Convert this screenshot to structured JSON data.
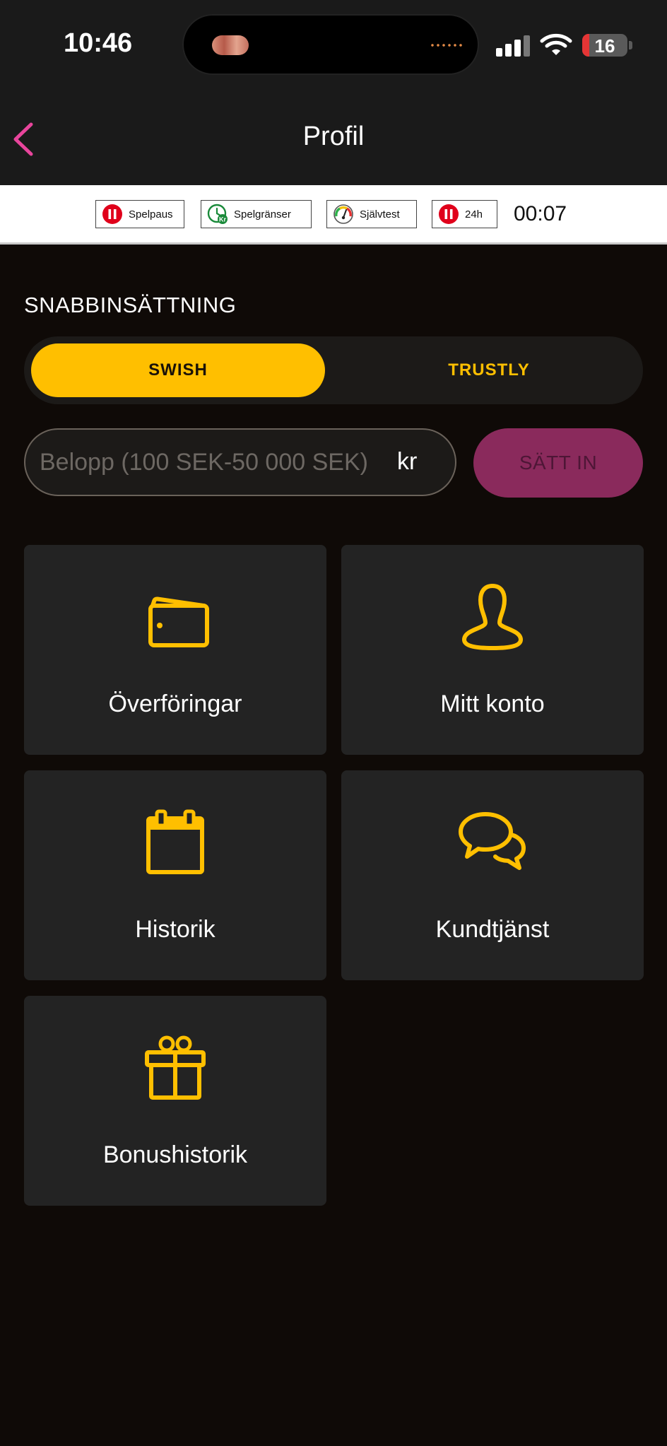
{
  "status_bar": {
    "time": "10:46",
    "battery_level": "16"
  },
  "header": {
    "title": "Profil",
    "back_icon": "chevron-left-icon"
  },
  "responsible_gaming": {
    "buttons": [
      {
        "label": "Spelpaus",
        "icon": "pause-icon"
      },
      {
        "label": "Spelgränser",
        "icon": "clock-limit-icon"
      },
      {
        "label": "Självtest",
        "icon": "gauge-icon"
      },
      {
        "label": "24h",
        "icon": "pause-icon"
      }
    ],
    "session_timer": "00:07"
  },
  "quick_deposit": {
    "title": "SNABBINSÄTTNING",
    "methods": [
      "SWISH",
      "TRUSTLY"
    ],
    "selected_method": "SWISH",
    "amount_placeholder": "Belopp (100 SEK-50 000 SEK)",
    "amount_value": "",
    "currency_unit": "kr",
    "submit_label": "SÄTT IN"
  },
  "menu": {
    "tiles": [
      {
        "label": "Överföringar",
        "icon": "wallet-icon"
      },
      {
        "label": "Mitt konto",
        "icon": "user-icon"
      },
      {
        "label": "Historik",
        "icon": "calendar-icon"
      },
      {
        "label": "Kundtjänst",
        "icon": "chat-bubbles-icon"
      },
      {
        "label": "Bonushistorik",
        "icon": "gift-icon"
      }
    ]
  },
  "colors": {
    "accent": "#ffbf00",
    "back_chevron": "#e8459c",
    "deposit_button": "#8a2a5c",
    "background": "#0f0a07",
    "tile": "#232323"
  }
}
